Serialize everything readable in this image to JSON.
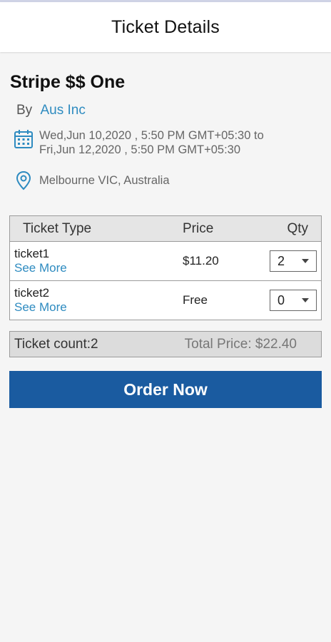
{
  "header": {
    "title": "Ticket Details"
  },
  "event": {
    "title": "Stripe $$ One",
    "organizer_prefix": "By",
    "organizer_name": "Aus Inc",
    "date_line1": "Wed,Jun 10,2020 , 5:50 PM GMT+05:30 to",
    "date_line2": "Fri,Jun 12,2020 , 5:50 PM GMT+05:30",
    "location": "Melbourne VIC, Australia",
    "calendar_icon": "calendar-icon",
    "location_icon": "location-pin-icon"
  },
  "table": {
    "headers": {
      "type": "Ticket Type",
      "price": "Price",
      "qty": "Qty"
    },
    "rows": [
      {
        "name": "ticket1",
        "link": "See More",
        "price": "$11.20",
        "qty": "2"
      },
      {
        "name": "ticket2",
        "link": "See More",
        "price": "Free",
        "qty": "0"
      }
    ]
  },
  "summary": {
    "count": "Ticket count:2",
    "total": "Total Price: $22.40"
  },
  "order_button": {
    "label": "Order Now"
  },
  "colors": {
    "accent": "#1a5ba0",
    "link": "#2e8bc0",
    "header_bg": "#ffffff",
    "page_bg": "#f5f5f5"
  }
}
